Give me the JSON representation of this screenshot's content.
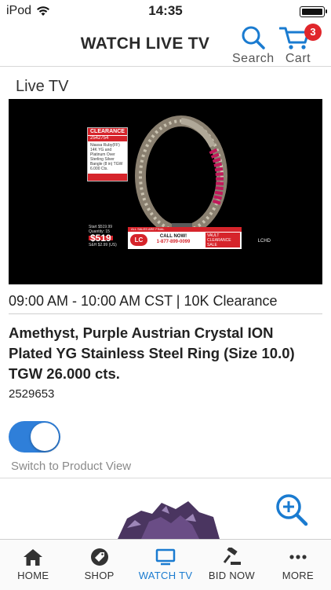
{
  "status_bar": {
    "carrier": "iPod",
    "time": "14:35"
  },
  "header": {
    "title": "WATCH LIVE TV",
    "search_label": "Search",
    "cart_label": "Cart",
    "cart_count": "3"
  },
  "section": {
    "title": "Live TV"
  },
  "video": {
    "tag_header": "CLEARANCE",
    "tag_number": "2542754",
    "tag_description": "Niassa Ruby(FF) 14K YG and Platinum Over Sterling Silver Bangle (8 in) TGW 6.000 Cts.",
    "start_price": "Start $519.99",
    "quantity": "Quantity: 15",
    "price": "$519",
    "shipping": "S&H $2.99 (US)",
    "banner_top": "ALL SALES ARE FINAL",
    "logo": "LC",
    "call_now": "CALL NOW!",
    "phone": "1-877-899-0099",
    "vault_text": "VAULT CLEARANCE SALE",
    "hd_mark": "LCHD"
  },
  "program": {
    "schedule": "09:00 AM - 10:00 AM CST | 10K Clearance"
  },
  "product": {
    "title": "Amethyst, Purple Austrian Crystal ION Plated YG Stainless Steel Ring (Size 10.0) TGW 26.000 cts.",
    "id": "2529653"
  },
  "product_view_toggle": {
    "on": true,
    "label": "Switch to Product View"
  },
  "tabbar": {
    "tabs": [
      {
        "label": "HOME",
        "icon": "home-icon",
        "active": false
      },
      {
        "label": "SHOP",
        "icon": "tag-icon",
        "active": false
      },
      {
        "label": "WATCH TV",
        "icon": "tv-icon",
        "active": true
      },
      {
        "label": "BID NOW",
        "icon": "gavel-icon",
        "active": false
      },
      {
        "label": "MORE",
        "icon": "more-icon",
        "active": false
      }
    ]
  },
  "colors": {
    "accent": "#1a7bd0",
    "badge": "#e0262b",
    "toggle": "#2f7fd9"
  }
}
